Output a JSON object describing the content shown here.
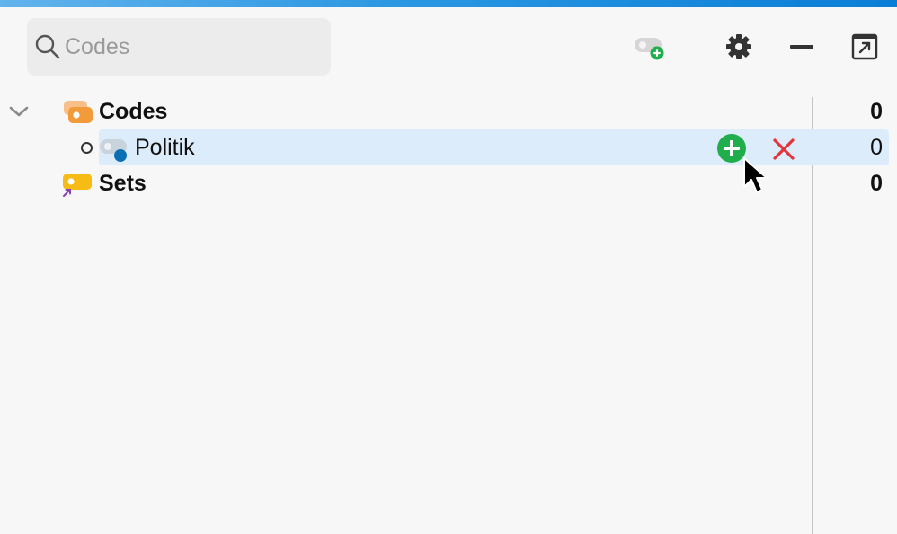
{
  "search": {
    "placeholder": "Codes",
    "value": ""
  },
  "toolbar": {
    "new_code_icon": "new-code-icon",
    "settings_icon": "gear-icon",
    "minimize_icon": "minus-icon",
    "undock_icon": "undock-icon"
  },
  "tree": {
    "root": {
      "label": "Codes",
      "count": "0",
      "expanded": true,
      "icon": "code-folder-icon"
    },
    "child": {
      "label": "Politik",
      "count": "0",
      "color": "#0b6fb3",
      "icon": "code-icon"
    },
    "sets": {
      "label": "Sets",
      "count": "0",
      "icon": "sets-icon"
    }
  },
  "colors": {
    "accent": "#0a7ed6",
    "selection": "#dcecfa",
    "add": "#1fae4b",
    "delete": "#e5333a",
    "codes_orange": "#f39a3a",
    "sets_yellow": "#f7bb16"
  }
}
